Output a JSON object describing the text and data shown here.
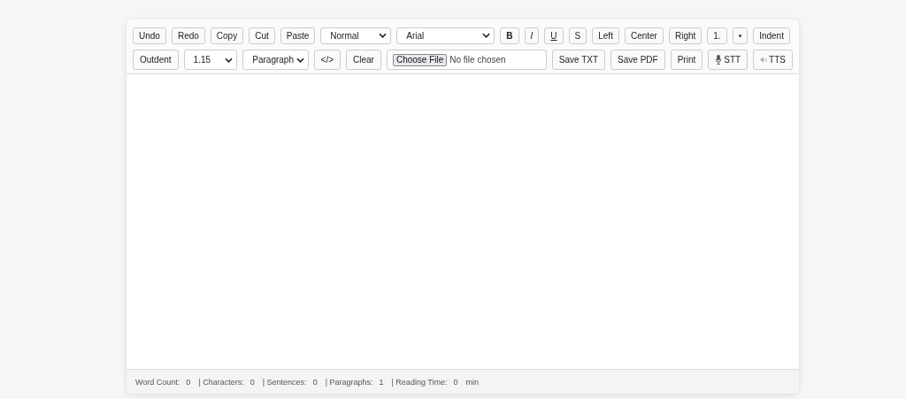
{
  "toolbar_rows": [
    [
      {
        "kind": "button",
        "label": "Undo"
      },
      {
        "kind": "button",
        "label": "Redo"
      },
      {
        "kind": "button",
        "label": "Copy"
      },
      {
        "kind": "button",
        "label": "Cut"
      },
      {
        "kind": "button",
        "label": "Paste"
      },
      {
        "kind": "select",
        "label": "Normal"
      },
      {
        "kind": "select",
        "label": "Arial"
      },
      {
        "kind": "bold",
        "label": "B"
      },
      {
        "kind": "italic",
        "label": "I"
      },
      {
        "kind": "underline",
        "label": "U"
      },
      {
        "kind": "button",
        "label": "S"
      },
      {
        "kind": "button",
        "label": "Left"
      },
      {
        "kind": "button",
        "label": "Center"
      },
      {
        "kind": "button",
        "label": "Right"
      },
      {
        "kind": "button",
        "label": "1."
      },
      {
        "kind": "button",
        "label": "•"
      },
      {
        "kind": "button",
        "label": "Indent"
      }
    ],
    [
      {
        "kind": "button",
        "label": "Outdent"
      },
      {
        "kind": "select",
        "label": "1.15"
      },
      {
        "kind": "select",
        "label": "Paragraph"
      },
      {
        "kind": "button",
        "label": "</>"
      },
      {
        "kind": "button",
        "label": "Clear"
      },
      {
        "kind": "file",
        "label": "Choose File",
        "status": "No file chosen"
      },
      {
        "kind": "button",
        "label": "Save TXT"
      },
      {
        "kind": "button",
        "label": "Save PDF"
      },
      {
        "kind": "button",
        "label": "Print"
      },
      {
        "kind": "mic",
        "label": "STT"
      },
      {
        "kind": "speaker",
        "label": "TTS"
      }
    ]
  ],
  "status_bar": [
    {
      "label": "Word Count:",
      "value": "0"
    },
    {
      "label": "| Characters:",
      "value": "0"
    },
    {
      "label": "| Sentences:",
      "value": "0"
    },
    {
      "label": "| Paragraphs:",
      "value": "1"
    },
    {
      "label": "| Reading Time:",
      "value": "0"
    }
  ],
  "reading_unit": "min"
}
